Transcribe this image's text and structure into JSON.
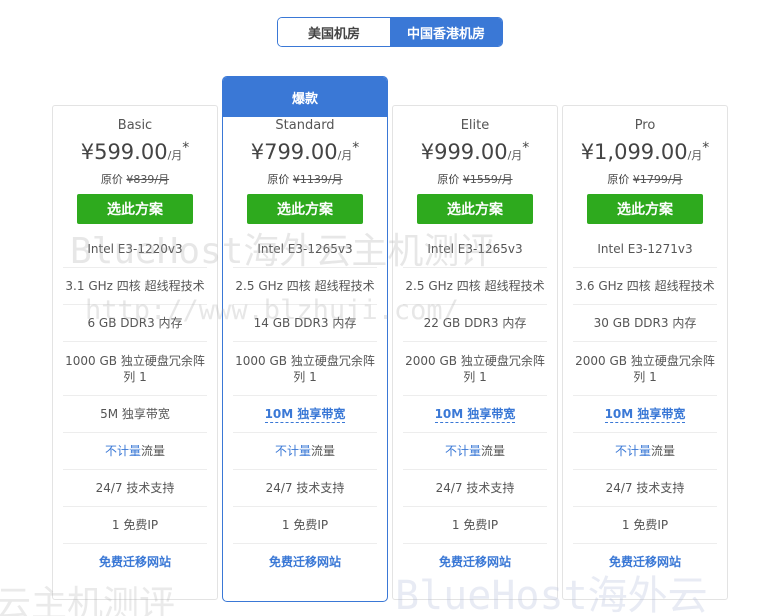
{
  "tabs": [
    {
      "label": "美国机房",
      "active": false
    },
    {
      "label": "中国香港机房",
      "active": true
    }
  ],
  "plans": [
    {
      "name": "Basic",
      "featured": false,
      "badge": "",
      "price": "¥599.00",
      "per": "/月",
      "star": "*",
      "orig_label": "原价",
      "orig_price": "¥839/月",
      "button": "选此方案",
      "cpu": "Intel E3-1220v3",
      "cores": "3.1 GHz 四核 超线程技术",
      "ram": "6 GB DDR3 内存",
      "storage": "1000 GB 独立硬盘冗余阵列 1",
      "bandwidth": "5M 独享带宽",
      "traffic_a": "不计量",
      "traffic_b": " 流量",
      "support": "24/7 技术支持",
      "ip": "1 免费IP",
      "migration": "免费迁移网站"
    },
    {
      "name": "Standard",
      "featured": true,
      "badge": "爆款",
      "price": "¥799.00",
      "per": "/月",
      "star": "*",
      "orig_label": "原价",
      "orig_price": "¥1139/月",
      "button": "选此方案",
      "cpu": "Intel E3-1265v3",
      "cores": "2.5 GHz 四核 超线程技术",
      "ram": "14 GB DDR3 内存",
      "storage": "1000 GB 独立硬盘冗余阵列 1",
      "bandwidth": "10M 独享带宽",
      "traffic_a": "不计量",
      "traffic_b": " 流量",
      "support": "24/7 技术支持",
      "ip": "1 免费IP",
      "migration": "免费迁移网站"
    },
    {
      "name": "Elite",
      "featured": false,
      "badge": "",
      "price": "¥999.00",
      "per": "/月",
      "star": "*",
      "orig_label": "原价",
      "orig_price": "¥1559/月",
      "button": "选此方案",
      "cpu": "Intel E3-1265v3",
      "cores": "2.5 GHz 四核 超线程技术",
      "ram": "22 GB DDR3 内存",
      "storage": "2000 GB 独立硬盘冗余阵列 1",
      "bandwidth": "10M 独享带宽",
      "traffic_a": "不计量",
      "traffic_b": " 流量",
      "support": "24/7 技术支持",
      "ip": "1 免费IP",
      "migration": "免费迁移网站"
    },
    {
      "name": "Pro",
      "featured": false,
      "badge": "",
      "price": "¥1,099.00",
      "per": "/月",
      "star": "*",
      "orig_label": "原价",
      "orig_price": "¥1799/月",
      "button": "选此方案",
      "cpu": "Intel E3-1271v3",
      "cores": "3.6 GHz 四核 超线程技术",
      "ram": "30 GB DDR3 内存",
      "storage": "2000 GB 独立硬盘冗余阵列 1",
      "bandwidth": "10M 独享带宽",
      "traffic_a": "不计量",
      "traffic_b": " 流量",
      "support": "24/7 技术支持",
      "ip": "1 免费IP",
      "migration": "免费迁移网站"
    }
  ],
  "watermarks": {
    "line1": "BlueHost海外云主机测评",
    "line2": "http://www.blzhuji.com/",
    "line3": "云主机测评",
    "line4": "BlueHost海外云"
  },
  "colors": {
    "accent": "#3a78d6",
    "button_green": "#2eaa1e"
  }
}
